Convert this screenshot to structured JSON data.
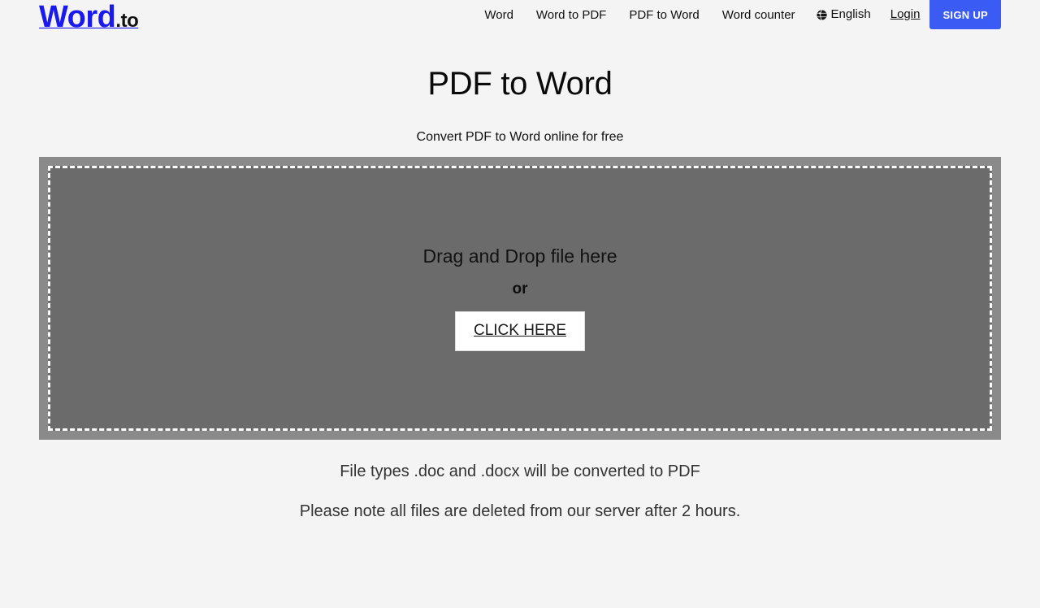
{
  "brand": {
    "name": "Word",
    "suffix": ".to",
    "color": "#1a1aee"
  },
  "nav": {
    "links": [
      {
        "label": "Word"
      },
      {
        "label": "Word to PDF"
      },
      {
        "label": "PDF to Word"
      },
      {
        "label": "Word counter"
      }
    ],
    "language": {
      "icon": "globe-icon",
      "label": "English"
    },
    "login_label": "Login",
    "signup_label": "SIGN UP",
    "signup_color": "#3b5bf5"
  },
  "hero": {
    "title": "PDF to Word",
    "subtitle": "Convert PDF to Word online for free"
  },
  "dropzone": {
    "drag_text": "Drag and Drop file here",
    "or_text": "or",
    "button_label": "CLICK HERE",
    "frame_color": "#8a8a8a",
    "fill_color": "#6b6b6b",
    "dash_color": "#ffffff"
  },
  "notes": {
    "line_1": "File types .doc and .docx will be converted to PDF",
    "line_2": "Please note all files are deleted from our server after 2 hours."
  }
}
